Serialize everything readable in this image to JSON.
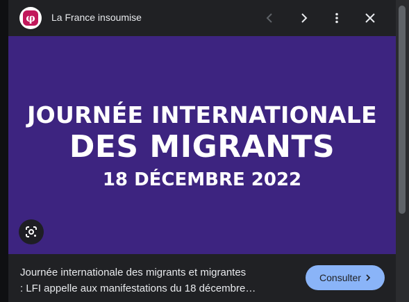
{
  "header": {
    "site_name": "La France insoumise",
    "logo_glyph": "φ",
    "icons": [
      "chevron-left-icon",
      "chevron-right-icon",
      "more-vert-icon",
      "close-icon"
    ]
  },
  "image": {
    "line1": "JOURNÉE INTERNATIONALE",
    "line2": "DES MIGRANTS",
    "line3": "18 DÉCEMBRE 2022",
    "background": "#3d2480"
  },
  "caption": {
    "line1": "Journée internationale des migrants et migrantes",
    "line2": ": LFI appelle aux manifestations du 18 décembre…"
  },
  "actions": {
    "consult_label": "Consulter",
    "accent": "#8ab4f8"
  }
}
